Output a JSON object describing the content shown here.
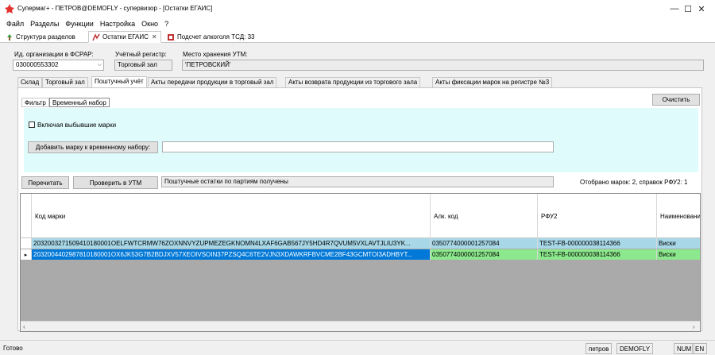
{
  "window": {
    "title": "Супермаг+ - ПЕТРОВ@DEMOFLY - супервизор  - [Остатки ЕГАИС]",
    "minimize": "—",
    "maximize": "☐",
    "close": "✕"
  },
  "menu": [
    "Файл",
    "Разделы",
    "Функции",
    "Настройка",
    "Окно",
    "?"
  ],
  "doc_tabs": [
    {
      "label": "Структура разделов"
    },
    {
      "label": "Остатки ЕГАИС",
      "close": "✕"
    },
    {
      "label": "Подсчет алкоголя ТСД: 33"
    }
  ],
  "org": {
    "fsrar_label": "Ид. организации в ФСРАР:",
    "fsrar_value": "030000553302",
    "register_label": "Учётный регистр:",
    "register_value": "Торговый зал",
    "utm_label": "Место хранения УТМ:",
    "utm_value": "'ПЕТРОВСКИЙ'"
  },
  "tabs": [
    "Склад",
    "Торговый зал",
    "Поштучный учёт",
    "Акты передачи продукции в торговый зал",
    "Акты возврата продукции из торгового зала",
    "Акты фиксации марок на регистре №3"
  ],
  "subtabs": [
    "Фильтр",
    "Временный набор"
  ],
  "buttons": {
    "clear": "Очистить",
    "add_mark": "Добавить марку к временному набору:",
    "recount": "Перечитать",
    "check_utm": "Проверить в УТМ"
  },
  "filter": {
    "include_retired": "Включая выбывшие марки",
    "mark_input_value": ""
  },
  "status_field": "Поштучные остатки по партиям получены",
  "selected_summary": "Отобрано марок: 2, справок РФУ2: 1",
  "grid": {
    "columns": [
      "Код марки",
      "Алк. код",
      "РФУ2",
      "Наименовани"
    ],
    "rows": [
      {
        "mark": "2032003271509410180001OELFWTCRMW76ZOXNNVYZUPMEZEGKNOMN4LXAF6GAB567JY5HD4R7QVUM5VXLAVTJLIU3YK...",
        "alc": "0350774000001257084",
        "rfu2": "TEST-FB-000000038114366",
        "name": "Виски",
        "selected": false
      },
      {
        "mark": "2032004402987810180001OX6JK53G7B2BDJXV57XEOIVSOIN37PZSQ4C6TE2VJN3XDAWKRFBVCME2BF43GCMTOI3ADHBYT...",
        "alc": "0350774000001257084",
        "rfu2": "TEST-FB-000000038114366",
        "name": "Виски",
        "selected": true
      }
    ]
  },
  "statusbar": {
    "ready": "Готово",
    "user": "петров",
    "db": "DEMOFLY",
    "num": "NUM",
    "lang": "EN"
  },
  "colors": {
    "row_blue": "#a8d8e8",
    "row_green": "#8ce88c",
    "selected_cell": "#0078d7",
    "filter_panel": "#e0fbfb"
  }
}
